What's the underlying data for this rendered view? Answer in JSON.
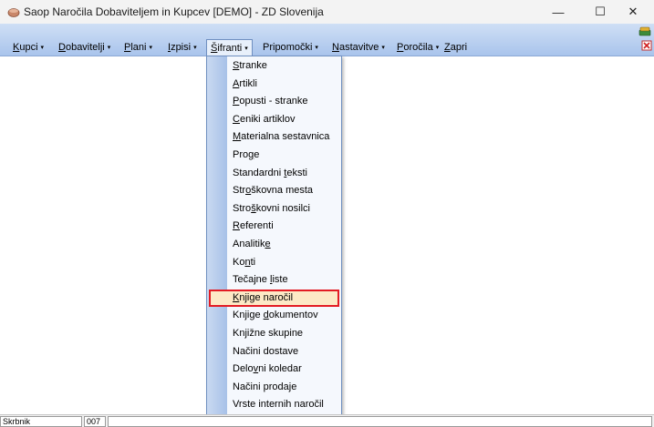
{
  "window": {
    "title": "Saop Naročila Dobaviteljem in Kupcev [DEMO] - ZD Slovenija",
    "minimize_glyph": "—",
    "maximize_glyph": "☐",
    "close_glyph": "✕"
  },
  "menubar": {
    "items": [
      {
        "first": "K",
        "rest": "upci",
        "arrow": "▾"
      },
      {
        "first": "D",
        "rest": "obavitelji",
        "arrow": "▾"
      },
      {
        "first": "P",
        "rest": "lani",
        "arrow": "▾"
      },
      {
        "first": "I",
        "rest": "zpisi",
        "arrow": "▾"
      },
      {
        "first": "Š",
        "rest": "ifranti",
        "arrow": "▾"
      },
      {
        "first": "Pripo",
        "rest": "močki",
        "arrow": "▾"
      },
      {
        "first": "N",
        "rest": "astavitve",
        "arrow": "▾"
      },
      {
        "first": "P",
        "rest": "oročila",
        "arrow": "▾"
      },
      {
        "first": "Z",
        "rest": "apri",
        "arrow": ""
      }
    ],
    "active_index": 4
  },
  "dropdown": {
    "items": [
      {
        "pre": "",
        "u": "S",
        "post": "tranke"
      },
      {
        "pre": "",
        "u": "A",
        "post": "rtikli"
      },
      {
        "pre": "",
        "u": "P",
        "post": "opusti - stranke"
      },
      {
        "pre": "",
        "u": "C",
        "post": "eniki artiklov"
      },
      {
        "pre": "",
        "u": "M",
        "post": "aterialna sestavnica"
      },
      {
        "pre": "Pro",
        "u": "g",
        "post": "e"
      },
      {
        "pre": "Standardni ",
        "u": "t",
        "post": "eksti"
      },
      {
        "pre": "Str",
        "u": "o",
        "post": "škovna mesta"
      },
      {
        "pre": "Stro",
        "u": "š",
        "post": "kovni nosilci"
      },
      {
        "pre": "",
        "u": "R",
        "post": "eferenti"
      },
      {
        "pre": "Analitik",
        "u": "e",
        "post": ""
      },
      {
        "pre": "Ko",
        "u": "n",
        "post": "ti"
      },
      {
        "pre": "Tečajne ",
        "u": "l",
        "post": "iste"
      },
      {
        "pre": "",
        "u": "K",
        "post": "njige naročil"
      },
      {
        "pre": "Knjige ",
        "u": "d",
        "post": "okumentov"
      },
      {
        "pre": "Knjižne skupine",
        "u": "",
        "post": ""
      },
      {
        "pre": "Načini dostave",
        "u": "",
        "post": ""
      },
      {
        "pre": "Delo",
        "u": "v",
        "post": "ni koledar"
      },
      {
        "pre": "Načini prodaje",
        "u": "",
        "post": ""
      },
      {
        "pre": "Vrste internih naročil",
        "u": "",
        "post": ""
      }
    ],
    "selected_index": 13
  },
  "statusbar": {
    "user": "Skrbnik",
    "code": "007",
    "message": ""
  },
  "colors": {
    "menubar_top": "#cfdff5",
    "menubar_bottom": "#a9c4ec",
    "highlight_border": "#e31b23",
    "highlight_fill": "#fde9c6"
  },
  "icons": {
    "app": "app-bowl-icon",
    "books": "books-icon",
    "exit": "exit-icon"
  }
}
